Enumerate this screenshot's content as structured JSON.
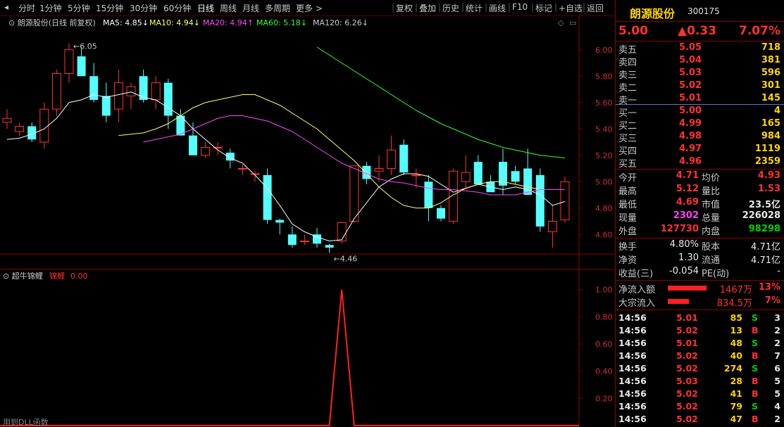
{
  "toolbar": {
    "periods": [
      "分时",
      "1分钟",
      "5分钟",
      "15分钟",
      "30分钟",
      "60分钟",
      "日线",
      "周线",
      "月线",
      "多周期",
      "更多"
    ],
    "active": "日线",
    "actions": [
      "复权",
      "叠加",
      "历史",
      "统计",
      "画线",
      "F10",
      "标记",
      "+自选",
      "返回"
    ]
  },
  "chart_header": {
    "title": "朗源股份(日线 前复权)",
    "ma": [
      {
        "label": "MA5: 4.85",
        "arrow": "↓",
        "color": "#ffffff"
      },
      {
        "label": "MA10: 4.94",
        "arrow": "↓",
        "color": "#ffff66"
      },
      {
        "label": "MA20: 4.94",
        "arrow": "↑",
        "color": "#ff44ff"
      },
      {
        "label": "MA60: 5.18",
        "arrow": "↓",
        "color": "#33ff33"
      },
      {
        "label": "MA120: 6.26",
        "arrow": "↓",
        "color": "#c8c8c8"
      }
    ]
  },
  "chart_data": [
    {
      "type": "candlestick",
      "y_ticks": [
        "6.00",
        "5.80",
        "5.60",
        "5.40",
        "5.20",
        "5.00",
        "4.80",
        "4.60"
      ],
      "ylim": [
        4.5,
        6.1
      ],
      "annotations": [
        {
          "text": "6.05",
          "value": 6.05
        },
        {
          "text": "4.46",
          "value": 4.46
        }
      ],
      "candles": [
        [
          5.45,
          5.55,
          5.4,
          5.48
        ],
        [
          5.38,
          5.45,
          5.35,
          5.42
        ],
        [
          5.42,
          5.45,
          5.3,
          5.32
        ],
        [
          5.3,
          5.6,
          5.25,
          5.55
        ],
        [
          5.55,
          5.85,
          5.5,
          5.82
        ],
        [
          5.82,
          6.05,
          5.75,
          6.0
        ],
        [
          5.95,
          6.02,
          5.8,
          5.8
        ],
        [
          5.8,
          5.9,
          5.6,
          5.62
        ],
        [
          5.65,
          5.75,
          5.45,
          5.5
        ],
        [
          5.55,
          5.85,
          5.45,
          5.75
        ],
        [
          5.65,
          5.75,
          5.55,
          5.72
        ],
        [
          5.8,
          5.85,
          5.6,
          5.62
        ],
        [
          5.62,
          5.8,
          5.55,
          5.75
        ],
        [
          5.75,
          5.78,
          5.4,
          5.5
        ],
        [
          5.5,
          5.55,
          5.35,
          5.35
        ],
        [
          5.35,
          5.45,
          5.2,
          5.2
        ],
        [
          5.2,
          5.3,
          5.18,
          5.26
        ],
        [
          5.26,
          5.3,
          5.2,
          5.26
        ],
        [
          5.22,
          5.25,
          5.1,
          5.16
        ],
        [
          5.1,
          5.13,
          5.05,
          5.1
        ],
        [
          5.06,
          5.08,
          5.0,
          5.06
        ],
        [
          5.05,
          5.1,
          4.68,
          4.71
        ],
        [
          4.71,
          4.72,
          4.6,
          4.69
        ],
        [
          4.6,
          4.66,
          4.5,
          4.52
        ],
        [
          4.55,
          4.6,
          4.52,
          4.55
        ],
        [
          4.6,
          4.65,
          4.5,
          4.53
        ],
        [
          4.52,
          4.53,
          4.46,
          4.5
        ],
        [
          4.55,
          4.7,
          4.53,
          4.69
        ],
        [
          4.7,
          5.12,
          4.69,
          5.12
        ],
        [
          5.12,
          5.15,
          4.98,
          5.02
        ],
        [
          5.08,
          5.2,
          5.0,
          5.1
        ],
        [
          5.1,
          5.35,
          5.05,
          5.24
        ],
        [
          5.28,
          5.32,
          5.05,
          5.07
        ],
        [
          5.05,
          5.1,
          4.95,
          5.05
        ],
        [
          5.0,
          5.05,
          4.7,
          4.8
        ],
        [
          4.8,
          4.82,
          4.7,
          4.72
        ],
        [
          4.7,
          5.1,
          4.68,
          5.08
        ],
        [
          5.0,
          5.2,
          4.95,
          5.07
        ],
        [
          5.15,
          5.2,
          4.98,
          4.98
        ],
        [
          5.0,
          5.05,
          4.95,
          4.92
        ],
        [
          5.15,
          5.25,
          4.9,
          4.97
        ],
        [
          5.08,
          5.12,
          4.98,
          5.0
        ],
        [
          5.1,
          5.25,
          4.9,
          4.9
        ],
        [
          5.05,
          5.1,
          4.62,
          4.66
        ],
        [
          4.62,
          4.82,
          4.5,
          4.7
        ],
        [
          4.71,
          5.04,
          4.69,
          5.0
        ]
      ],
      "ma_lines": [
        {
          "name": "MA5",
          "color": "#ffffff",
          "values": [
            5.32,
            5.33,
            5.36,
            5.4,
            5.48,
            5.6,
            5.62,
            5.66,
            5.64,
            5.66,
            5.68,
            5.64,
            5.62,
            5.56,
            5.5,
            5.4,
            5.32,
            5.24,
            5.18,
            5.14,
            5.05,
            4.95,
            4.82,
            4.68,
            4.62,
            4.58,
            4.55,
            4.56,
            4.72,
            4.84,
            4.96,
            5.02,
            5.06,
            5.06,
            5.04,
            4.98,
            4.92,
            4.95,
            4.98,
            4.96,
            4.94,
            4.96,
            4.94,
            4.9,
            4.82,
            4.85
          ]
        },
        {
          "name": "MA10",
          "color": "#ffff66",
          "values": [
            5.35,
            5.36,
            5.37,
            5.4,
            5.44,
            5.5,
            5.56,
            5.6,
            5.62,
            5.64,
            5.66,
            5.66,
            5.62,
            5.58,
            5.52,
            5.46,
            5.4,
            5.32,
            5.24,
            5.16,
            5.06,
            4.96,
            4.88,
            4.82,
            4.8,
            4.8,
            4.84,
            4.9,
            4.95,
            4.98,
            5.0,
            5.0,
            4.98,
            4.96,
            4.94,
            4.94,
            4.94
          ]
        },
        {
          "name": "MA20",
          "color": "#ff44ff",
          "values": [
            5.3,
            5.32,
            5.34,
            5.36,
            5.4,
            5.44,
            5.48,
            5.5,
            5.5,
            5.48,
            5.46,
            5.42,
            5.38,
            5.32,
            5.26,
            5.2,
            5.14,
            5.1,
            5.06,
            5.02,
            5.0,
            4.99,
            4.97,
            4.95,
            4.94,
            4.94,
            4.93,
            4.92,
            4.9,
            4.9,
            4.9,
            4.92,
            4.94,
            4.94,
            4.94
          ]
        },
        {
          "name": "MA60",
          "color": "#33ff33",
          "values": [
            6.02,
            5.96,
            5.9,
            5.84,
            5.78,
            5.72,
            5.66,
            5.6,
            5.54,
            5.49,
            5.44,
            5.4,
            5.36,
            5.32,
            5.29,
            5.26,
            5.24,
            5.22,
            5.2,
            5.19,
            5.18
          ]
        }
      ]
    },
    {
      "type": "line",
      "name_label": "超牛锦鲤",
      "series_label": "锦鲤",
      "series_value": "0.00",
      "y_ticks": [
        "1.00",
        "0.80",
        "0.60",
        "0.40",
        "0.20"
      ],
      "ylim": [
        0,
        1.05
      ],
      "values": [
        0,
        0,
        0,
        0,
        0,
        0,
        0,
        0,
        0,
        0,
        0,
        0,
        0,
        0,
        0,
        0,
        0,
        0,
        0,
        0,
        0,
        0,
        0,
        0,
        0,
        0,
        0,
        1,
        0,
        0,
        0,
        0,
        0,
        0,
        0,
        0,
        0,
        0,
        0,
        0,
        0,
        0,
        0,
        0,
        0,
        0
      ],
      "footer": "用到DLL函数"
    }
  ],
  "stock": {
    "name": "朗源股份",
    "code": "300175",
    "price": "5.00",
    "change": "▲0.33",
    "change_pct": "7.07%"
  },
  "order_book": {
    "asks": [
      {
        "label": "卖五",
        "price": "5.05",
        "vol": "718"
      },
      {
        "label": "卖四",
        "price": "5.04",
        "vol": "381"
      },
      {
        "label": "卖三",
        "price": "5.03",
        "vol": "596"
      },
      {
        "label": "卖二",
        "price": "5.02",
        "vol": "301"
      },
      {
        "label": "卖一",
        "price": "5.01",
        "vol": "145"
      }
    ],
    "bids": [
      {
        "label": "买一",
        "price": "5.00",
        "vol": "4"
      },
      {
        "label": "买二",
        "price": "4.99",
        "vol": "165"
      },
      {
        "label": "买三",
        "price": "4.98",
        "vol": "984"
      },
      {
        "label": "买四",
        "price": "4.97",
        "vol": "1119"
      },
      {
        "label": "买五",
        "price": "4.96",
        "vol": "2359"
      }
    ]
  },
  "stats": [
    {
      "l1": "今开",
      "v1": "4.71",
      "c1": "red",
      "l2": "均价",
      "v2": "4.93",
      "c2": "red"
    },
    {
      "l1": "最高",
      "v1": "5.12",
      "c1": "red",
      "l2": "量比",
      "v2": "1.53",
      "c2": "red"
    },
    {
      "l1": "最低",
      "v1": "4.69",
      "c1": "red",
      "l2": "市值",
      "v2": "23.5亿",
      "c2": "white"
    },
    {
      "l1": "现量",
      "v1": "2302",
      "c1": "mag",
      "l2": "总量",
      "v2": "226028",
      "c2": "white"
    },
    {
      "l1": "外盘",
      "v1": "127730",
      "c1": "red",
      "l2": "内盘",
      "v2": "98298",
      "c2": "green"
    }
  ],
  "finance": [
    {
      "l1": "换手",
      "v1": "4.80%",
      "l2": "股本",
      "v2": "4.71亿"
    },
    {
      "l1": "净资",
      "v1": "1.30",
      "l2": "流通",
      "v2": "4.71亿"
    },
    {
      "l1": "收益(三)",
      "v1": "-0.054",
      "l2": "PE(动)",
      "v2": "-"
    }
  ],
  "flows": [
    {
      "label": "净流入额",
      "value": "1467万",
      "pct": "13%",
      "bar": 0.55
    },
    {
      "label": "大宗流入",
      "value": "834.5万",
      "pct": "7%",
      "bar": 0.3
    }
  ],
  "ticks": [
    {
      "time": "14:56",
      "price": "5.01",
      "vol": "85",
      "side": "S",
      "n": "3"
    },
    {
      "time": "14:56",
      "price": "5.02",
      "vol": "13",
      "side": "B",
      "n": "2"
    },
    {
      "time": "14:56",
      "price": "5.01",
      "vol": "48",
      "side": "S",
      "n": "2"
    },
    {
      "time": "14:56",
      "price": "5.02",
      "vol": "40",
      "side": "B",
      "n": "7"
    },
    {
      "time": "14:56",
      "price": "5.02",
      "vol": "274",
      "side": "S",
      "n": "6"
    },
    {
      "time": "14:56",
      "price": "5.03",
      "vol": "28",
      "side": "B",
      "n": "5"
    },
    {
      "time": "14:56",
      "price": "5.02",
      "vol": "41",
      "side": "B",
      "n": "5"
    },
    {
      "time": "14:56",
      "price": "5.02",
      "vol": "79",
      "side": "S",
      "n": "4"
    },
    {
      "time": "14:56",
      "price": "5.02",
      "vol": "47",
      "side": "B",
      "n": "2"
    }
  ]
}
